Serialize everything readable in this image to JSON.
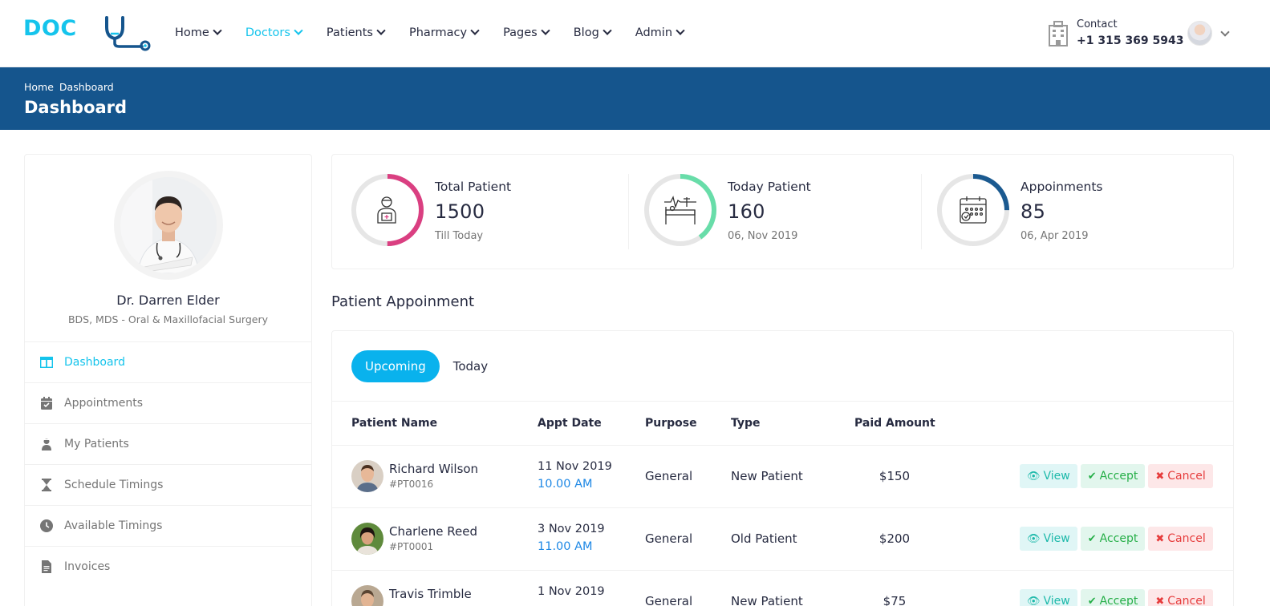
{
  "header": {
    "logo_text": "DOC",
    "nav": [
      {
        "label": "Home",
        "active": false
      },
      {
        "label": "Doctors",
        "active": true
      },
      {
        "label": "Patients",
        "active": false
      },
      {
        "label": "Pharmacy",
        "active": false
      },
      {
        "label": "Pages",
        "active": false
      },
      {
        "label": "Blog",
        "active": false
      },
      {
        "label": "Admin",
        "active": false
      }
    ],
    "contact_label": "Contact",
    "contact_phone": "+1 315 369 5943"
  },
  "breadcrumb": {
    "items": [
      "Home",
      "Dashboard"
    ],
    "title": "Dashboard"
  },
  "profile": {
    "name": "Dr. Darren Elder",
    "specialty": "BDS, MDS - Oral & Maxillofacial Surgery"
  },
  "sidebar": {
    "items": [
      {
        "label": "Dashboard",
        "icon": "columns-icon",
        "active": true
      },
      {
        "label": "Appointments",
        "icon": "calendar-check-icon",
        "active": false
      },
      {
        "label": "My Patients",
        "icon": "user-injured-icon",
        "active": false
      },
      {
        "label": "Schedule Timings",
        "icon": "hourglass-icon",
        "active": false
      },
      {
        "label": "Available Timings",
        "icon": "clock-icon",
        "active": false
      },
      {
        "label": "Invoices",
        "icon": "file-invoice-icon",
        "active": false
      }
    ]
  },
  "stats": [
    {
      "title": "Total Patient",
      "value": "1500",
      "sub": "Till Today",
      "color": "#da3f81",
      "progress": 0.5,
      "icon": "patient-icon"
    },
    {
      "title": "Today Patient",
      "value": "160",
      "sub": "06, Nov 2019",
      "color": "#68dda9",
      "progress": 0.4,
      "icon": "hospital-bed-icon"
    },
    {
      "title": "Appoinments",
      "value": "85",
      "sub": "06, Apr 2019",
      "color": "#1b5a90",
      "progress": 0.25,
      "icon": "calendar-icon"
    }
  ],
  "appointments": {
    "section_title": "Patient Appoinment",
    "tabs": [
      {
        "label": "Upcoming",
        "active": true
      },
      {
        "label": "Today",
        "active": false
      }
    ],
    "columns": [
      "Patient Name",
      "Appt Date",
      "Purpose",
      "Type",
      "Paid Amount"
    ],
    "action_labels": {
      "view": "View",
      "accept": "Accept",
      "cancel": "Cancel"
    },
    "rows": [
      {
        "name": "Richard Wilson",
        "id": "#PT0016",
        "date": "11 Nov 2019",
        "time": "10.00 AM",
        "purpose": "General",
        "type": "New Patient",
        "amount": "$150"
      },
      {
        "name": "Charlene Reed",
        "id": "#PT0001",
        "date": "3 Nov 2019",
        "time": "11.00 AM",
        "purpose": "General",
        "type": "Old Patient",
        "amount": "$200"
      },
      {
        "name": "Travis Trimble",
        "id": "",
        "date": "1 Nov 2019",
        "time": "",
        "purpose": "General",
        "type": "New Patient",
        "amount": "$75"
      }
    ]
  },
  "colors": {
    "primary": "#15c4ec",
    "header_bar": "#15558d",
    "tab_active": "#09b2ed",
    "time_text": "#1e88e5"
  }
}
